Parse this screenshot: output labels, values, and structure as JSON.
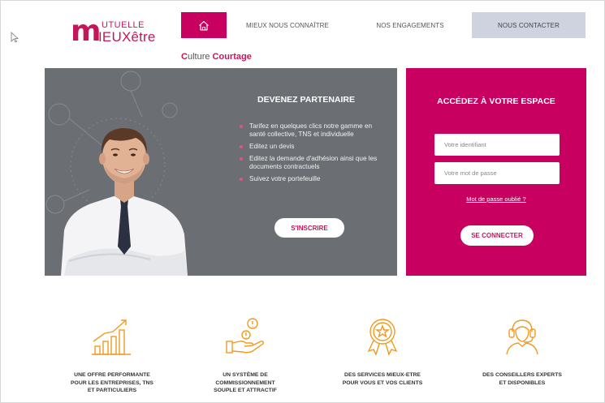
{
  "brand": {
    "logo_line1": "UTUELLE",
    "logo_line2": "IEUXêtre",
    "logo_initial": "m",
    "accent_color": "#c8005f"
  },
  "nav": {
    "home_icon": "home-icon",
    "items": [
      {
        "label": "MIEUX NOUS CONNAÎTRE"
      },
      {
        "label": "NOS ENGAGEMENTS"
      },
      {
        "label": "NOUS CONTACTER"
      }
    ]
  },
  "subtitle": {
    "first_letter": "C",
    "part1": "ulture ",
    "part2": "Courtage"
  },
  "hero": {
    "title": "DEVENEZ PARTENAIRE",
    "bullets": [
      "Tarifez en quelques clics notre gamme en santé collective, TNS et individuelle",
      "Editez un devis",
      "Editez la demande d'adhésion ainsi que les documents contractuels",
      "Suivez votre portefeuille"
    ],
    "signup_label": "S'INSCRIRE"
  },
  "login": {
    "title": "ACCÉDEZ À VOTRE ESPACE",
    "id_placeholder": "Votre identifiant",
    "password_placeholder": "Votre mot de passe",
    "forgot_label": "Mot de passe oublié ?",
    "connect_label": "SE CONNECTER"
  },
  "features": [
    {
      "icon": "growth-chart-icon",
      "lines": [
        "UNE OFFRE PERFORMANTE",
        "POUR LES ENTREPRISES, TNS",
        "ET PARTICULIERS"
      ]
    },
    {
      "icon": "hand-coins-icon",
      "lines": [
        "UN SYSTÈME DE",
        "COMMISSIONNEMENT",
        "SOUPLE ET ATTRACTIF"
      ]
    },
    {
      "icon": "award-star-icon",
      "lines": [
        "DES SERVICES MIEUX-ETRE",
        "POUR VOUS ET VOS CLIENTS"
      ]
    },
    {
      "icon": "advisor-headset-icon",
      "lines": [
        "DES CONSEILLERS EXPERTS",
        "ET DISPONIBLES"
      ]
    }
  ],
  "feature_icon_color": "#f29a1f"
}
